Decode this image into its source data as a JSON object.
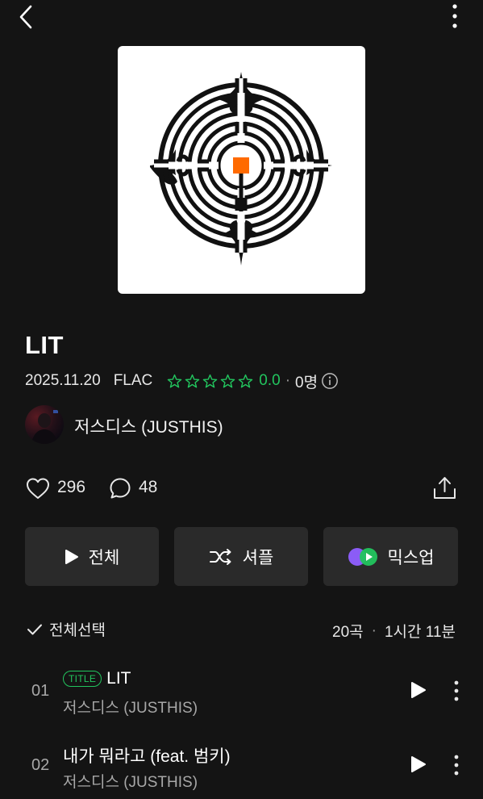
{
  "album": {
    "title": "LIT",
    "release_date": "2025.11.20",
    "format": "FLAC",
    "rating": "0.0",
    "rating_count": "0명",
    "artist": "저스디스 (JUSTHIS)",
    "likes": "296",
    "comments": "48",
    "cover_accent": "#ff6a00"
  },
  "actions": {
    "play_all": "전체",
    "shuffle": "셔플",
    "mixup": "믹스업"
  },
  "list_header": {
    "select_all": "전체선택",
    "count": "20곡",
    "duration": "1시간 11분"
  },
  "tracks": [
    {
      "number": "01",
      "badge": "TITLE",
      "title": "LIT",
      "artist": "저스디스 (JUSTHIS)"
    },
    {
      "number": "02",
      "badge": "",
      "title": "내가 뭐라고 (feat. 범키)",
      "artist": "저스디스 (JUSTHIS)"
    }
  ],
  "colors": {
    "background": "#141414",
    "button": "#2a2a2a",
    "accent_green": "#22c55e"
  }
}
